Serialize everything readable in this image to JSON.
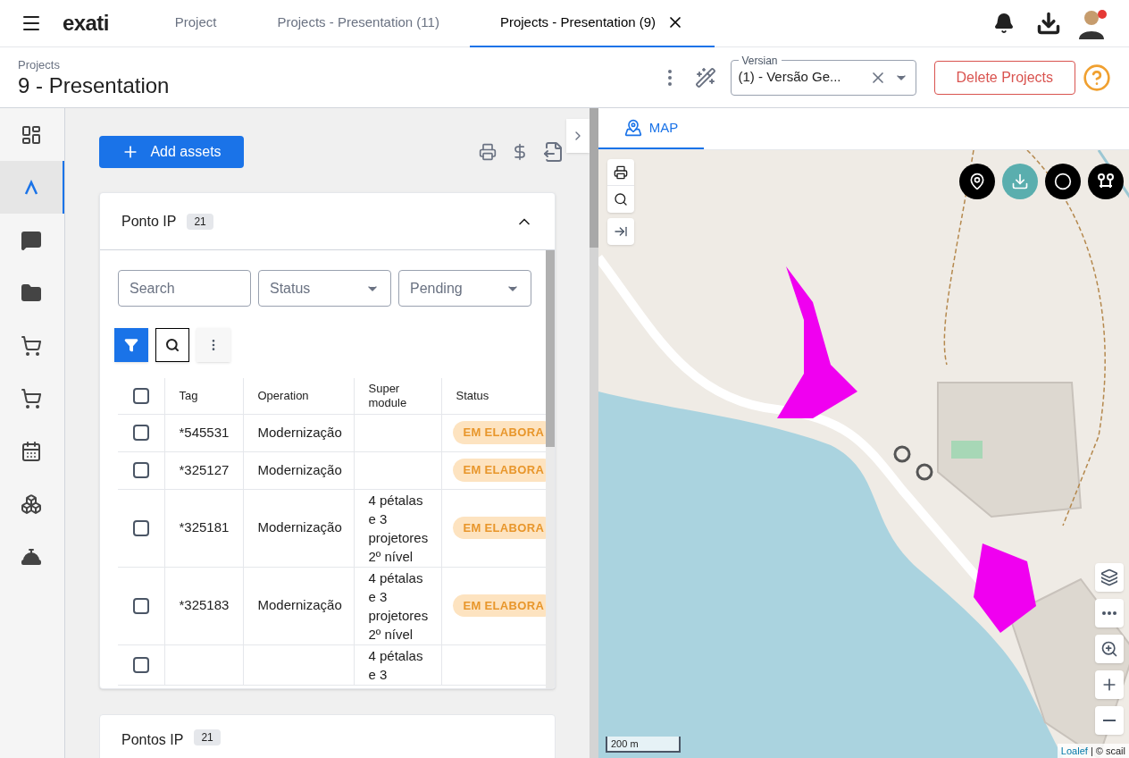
{
  "topbar": {
    "logo": "exati",
    "tabs": [
      {
        "label": "Project",
        "selected": false,
        "closable": false
      },
      {
        "label": "Projects - Presentation (11)",
        "selected": false,
        "closable": false
      },
      {
        "label": "Projects - Presentation (9)",
        "selected": true,
        "closable": true
      }
    ]
  },
  "header": {
    "breadcrumb": "Projects",
    "title": "9 - Presentation",
    "version": {
      "label": "Versian",
      "value": "(1) - Versão Ge..."
    },
    "delete_button": "Delete Projects"
  },
  "sidebar": {
    "items": [
      {
        "selected": false
      },
      {
        "selected": true
      },
      {
        "selected": false
      },
      {
        "selected": false
      },
      {
        "selected": false
      },
      {
        "selected": false
      },
      {
        "selected": false
      },
      {
        "selected": false
      },
      {
        "selected": false
      }
    ]
  },
  "add_button": "Add assets",
  "panel": {
    "title": "Ponto IP",
    "count": "21",
    "expanded": true,
    "filters": [
      {
        "kind": "text",
        "placeholder": "Search"
      },
      {
        "kind": "select",
        "placeholder": "Status"
      },
      {
        "kind": "select",
        "placeholder": "Pending"
      }
    ],
    "tools": [
      {
        "selected": true
      },
      {
        "selected": false
      },
      {
        "selected": false
      }
    ],
    "table": {
      "select_all_checked": false,
      "columns": [
        "Tag",
        "Operation",
        "Super module",
        "Status"
      ],
      "rows": [
        {
          "checked": false,
          "tag": "*545531",
          "operation": "Modernização",
          "status": "EM ELABORA"
        },
        {
          "checked": false,
          "tag": "*325127",
          "operation": "Modernização",
          "status": "EM ELABORA"
        },
        {
          "checked": false,
          "tag": "*325181",
          "operation": "Modernização",
          "super_module": "4 pétalas e 3 projetores 2º nível",
          "status": "EM ELABORA"
        },
        {
          "checked": false,
          "tag": "*325183",
          "operation": "Modernização",
          "super_module": "4 pétalas e 3 projetores 2º nível",
          "status": "EM ELABORA"
        },
        {
          "checked": false,
          "super_module": "4 pétalas e 3"
        }
      ]
    }
  },
  "second_panel": {
    "title": "Pontos IP",
    "count": "21"
  },
  "map": {
    "tab": "MAP",
    "scale": "200 m",
    "attribution_link": "Loalef",
    "attribution": "| © scail"
  }
}
